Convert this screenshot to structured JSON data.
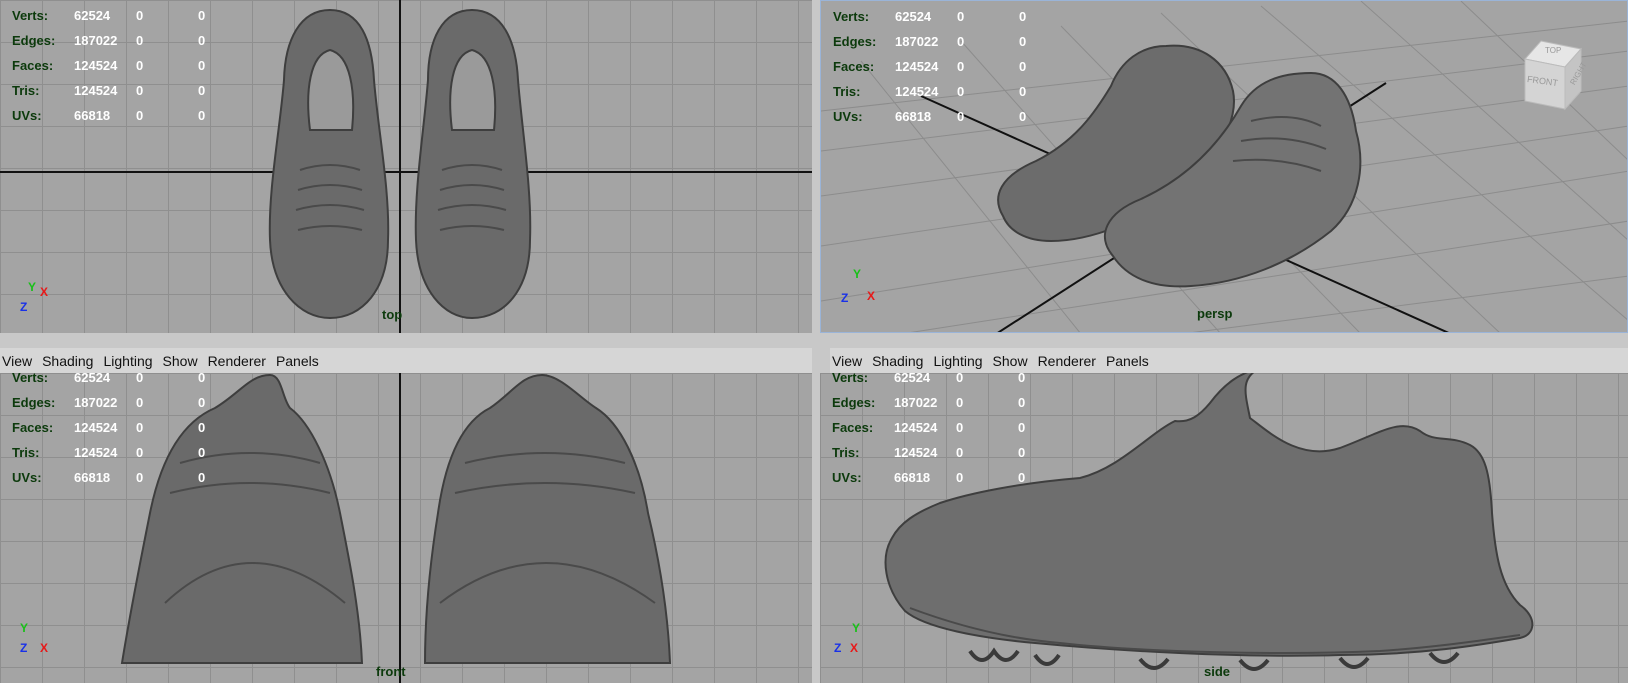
{
  "menu": [
    "View",
    "Shading",
    "Lighting",
    "Show",
    "Renderer",
    "Panels"
  ],
  "hud": {
    "rows": [
      {
        "label": "Verts:",
        "value": "62524",
        "c1": "0",
        "c2": "0"
      },
      {
        "label": "Edges:",
        "value": "187022",
        "c1": "0",
        "c2": "0"
      },
      {
        "label": "Faces:",
        "value": "124524",
        "c1": "0",
        "c2": "0"
      },
      {
        "label": "Tris:",
        "value": "124524",
        "c1": "0",
        "c2": "0"
      },
      {
        "label": "UVs:",
        "value": "66818",
        "c1": "0",
        "c2": "0"
      }
    ]
  },
  "viewports": {
    "top": {
      "camera": "top"
    },
    "persp": {
      "camera": "persp"
    },
    "front": {
      "camera": "front"
    },
    "side": {
      "camera": "side"
    }
  },
  "viewcube": {
    "top": "TOP",
    "front": "FRONT",
    "right": "RIGHT"
  },
  "axes": {
    "x": "X",
    "y": "Y",
    "z": "Z"
  },
  "colors": {
    "viewport_bg": "#a4a4a4",
    "grid": "#8f8f8f",
    "hud_label": "#0c3a0c",
    "hud_value": "#ffffff",
    "axis_x": "#e81818",
    "axis_y": "#18c018",
    "axis_z": "#1830e8",
    "selected_border": "#9ab4d8"
  }
}
